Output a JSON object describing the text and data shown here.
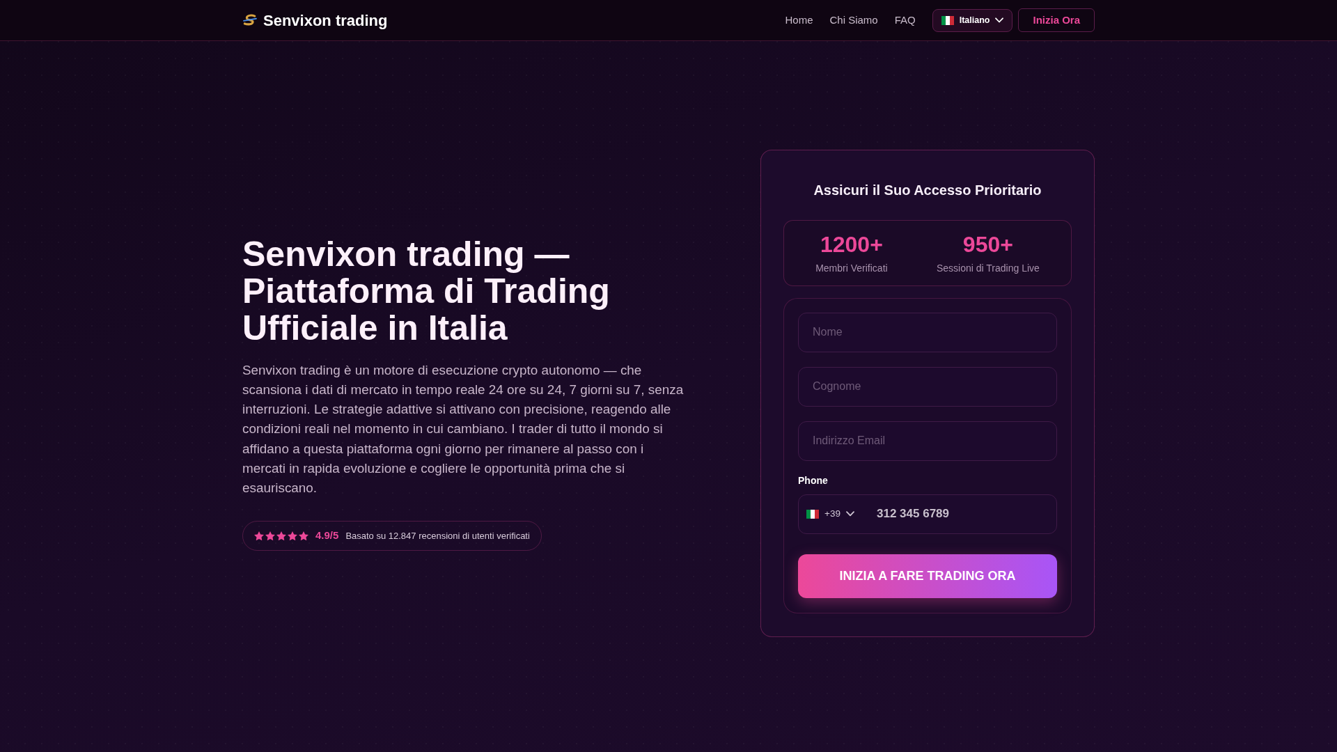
{
  "navbar": {
    "brand": "Senvixon trading",
    "links": [
      {
        "label": "Home"
      },
      {
        "label": "Chi Siamo"
      },
      {
        "label": "FAQ"
      }
    ],
    "language": {
      "label": "Italiano"
    },
    "cta": "Inizia Ora"
  },
  "hero": {
    "title": "Senvixon trading — Piattaforma di Trading Ufficiale in Italia",
    "description": "Senvixon trading è un motore di esecuzione crypto autonomo — che scansiona i dati di mercato in tempo reale 24 ore su 24, 7 giorni su 7, senza interruzioni. Le strategie adattive si attivano con precisione, reagendo alle condizioni reali nel momento in cui cambiano. I trader di tutto il mondo si affidano a questa piattaforma ogni giorno per rimanere al passo con i mercati in rapida evoluzione e cogliere le opportunità prima che si esauriscano.",
    "rating": {
      "stars": 5,
      "score": "4.9/5",
      "text": "Basato su 12.847 recensioni di utenti verificati"
    }
  },
  "signup": {
    "title": "Assicuri il Suo Accesso Prioritario",
    "stats": [
      {
        "value": "1200+",
        "label": "Membri Verificati"
      },
      {
        "value": "950+",
        "label": "Sessioni di Trading Live"
      }
    ],
    "fields": [
      {
        "kind": "text",
        "placeholder": "Nome"
      },
      {
        "kind": "text",
        "placeholder": "Cognome"
      },
      {
        "kind": "text",
        "placeholder": "Indirizzo Email"
      },
      {
        "kind": "phone",
        "label": "Phone",
        "country_code": "+39",
        "placeholder": "312 345 6789"
      }
    ],
    "submit": "INIZIA A FARE TRADING ORA"
  }
}
